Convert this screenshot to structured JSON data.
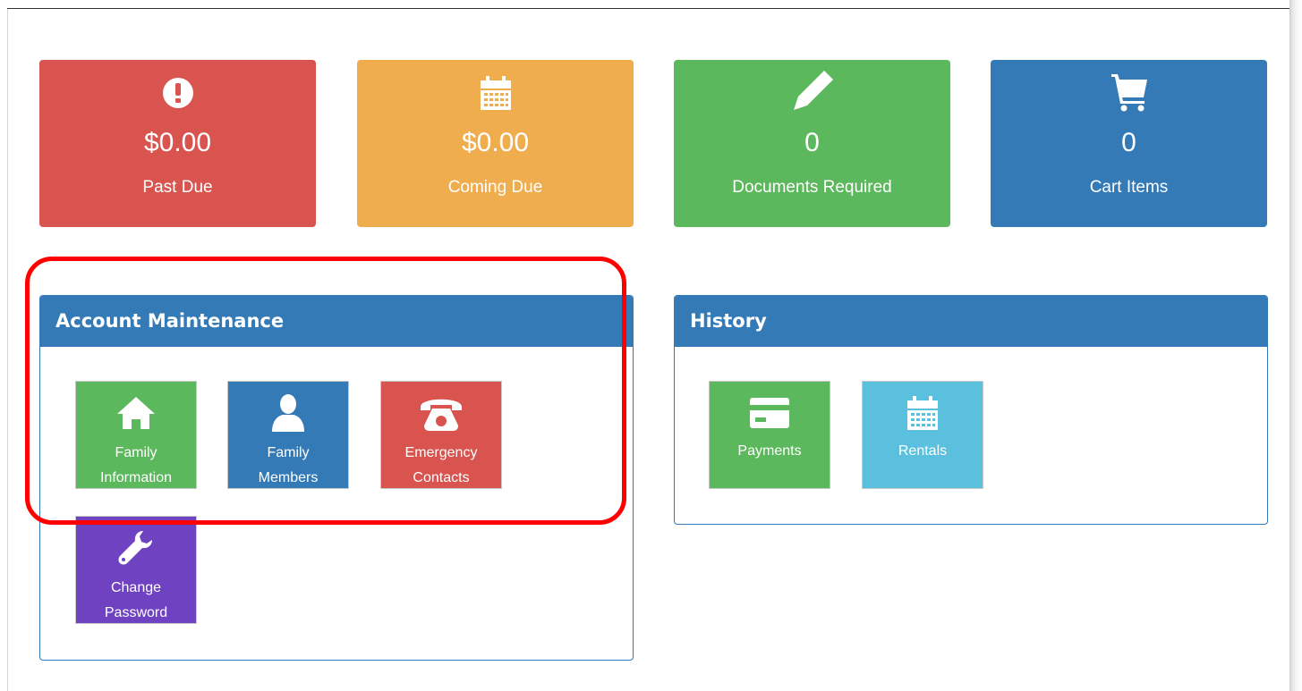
{
  "tiles": {
    "past_due": {
      "value": "$0.00",
      "label": "Past Due",
      "color": "#d9534f",
      "icon": "exclamation-circle-icon"
    },
    "coming_due": {
      "value": "$0.00",
      "label": "Coming Due",
      "color": "#f0ad4e",
      "icon": "calendar-icon"
    },
    "documents": {
      "value": "0",
      "label": "Documents Required",
      "color": "#5cb85c",
      "icon": "pencil-icon"
    },
    "cart": {
      "value": "0",
      "label": "Cart Items",
      "color": "#337ab7",
      "icon": "cart-icon"
    }
  },
  "account_maintenance": {
    "title": "Account Maintenance",
    "buttons": {
      "family_information": {
        "line1": "Family",
        "line2": "Information",
        "color": "#5cb85c",
        "icon": "home-icon"
      },
      "family_members": {
        "line1": "Family",
        "line2": "Members",
        "color": "#337ab7",
        "icon": "user-icon"
      },
      "emergency_contacts": {
        "line1": "Emergency",
        "line2": "Contacts",
        "color": "#d9534f",
        "icon": "phone-icon"
      },
      "change_password": {
        "line1": "Change",
        "line2": "Password",
        "color": "#6f42c1",
        "icon": "wrench-icon"
      }
    }
  },
  "history": {
    "title": "History",
    "buttons": {
      "payments": {
        "label": "Payments",
        "color": "#5cb85c",
        "icon": "credit-card-icon"
      },
      "rentals": {
        "label": "Rentals",
        "color": "#5bc0de",
        "icon": "calendar-icon"
      }
    }
  },
  "annotation": {
    "color": "#ff0000"
  }
}
